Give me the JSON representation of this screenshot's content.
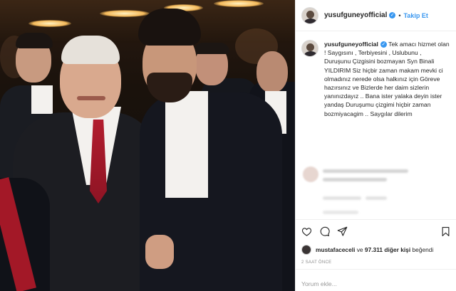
{
  "header": {
    "username": "yusufguneyofficial",
    "separator": "•",
    "follow_label": "Takip Et"
  },
  "caption": {
    "username": "yusufguneyofficial",
    "text": "Tek amacı hizmet olan ! Saygısını , Terbiyesini , Uslubunu , Duruşunu Çizgisini bozmayan Syn Binali YILDIRIM Siz hiçbir zaman makam mevki ci olmadınız nerede olsa halkınız için Göreve hazırsınız ve Bizlerde her daim sizlerin yanınızdayız .. Bana ister yalaka deyin ister yandaş Duruşumu çizgimi hiçbir zaman bozmiyacagim .. Saygılar dilerim"
  },
  "likes": {
    "liker": "mustafaceceli",
    "connector": " ve ",
    "count": "97.311 diğer kişi",
    "suffix": " beğendi"
  },
  "timestamp": "2 SAAT ÖNCE",
  "comment_box": {
    "placeholder": "Yorum ekle..."
  },
  "icons": [
    "heart-icon",
    "comment-icon",
    "share-icon",
    "bookmark-icon"
  ],
  "colors": {
    "accent": "#3897f0",
    "text": "#262626",
    "muted": "#8e8e8e"
  }
}
